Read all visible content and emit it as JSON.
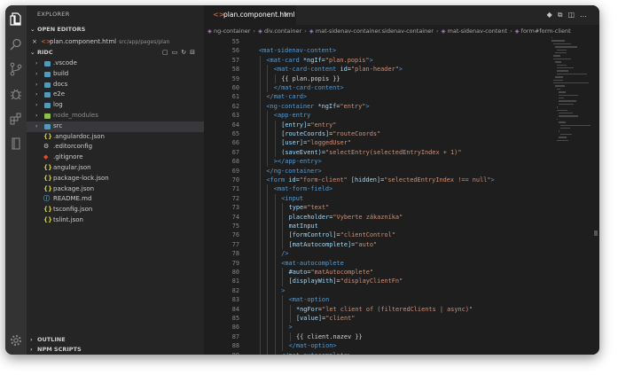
{
  "activity_bar": {
    "icons": [
      "files-icon",
      "search-icon",
      "source-control-icon",
      "debug-icon",
      "extensions-icon",
      "book-icon",
      "gear-icon"
    ]
  },
  "sidebar": {
    "title": "EXPLORER",
    "open_editors": {
      "label": "OPEN EDITORS",
      "file": "plan.component.html",
      "path": "src/app/pages/plan"
    },
    "root": {
      "label": "RIDC"
    },
    "tree": [
      {
        "name": ".vscode",
        "type": "folder",
        "color": "#519aba"
      },
      {
        "name": "build",
        "type": "folder",
        "color": "#519aba"
      },
      {
        "name": "docs",
        "type": "folder",
        "color": "#519aba"
      },
      {
        "name": "e2e",
        "type": "folder",
        "color": "#519aba"
      },
      {
        "name": "log",
        "type": "folder",
        "color": "#519aba"
      },
      {
        "name": "node_modules",
        "type": "folder",
        "color": "#8dc149",
        "dim": true
      },
      {
        "name": "src",
        "type": "folder",
        "color": "#519aba",
        "selected": true
      },
      {
        "name": ".angulardoc.json",
        "type": "file",
        "glyph": "{}",
        "color": "#cbcb41"
      },
      {
        "name": ".editorconfig",
        "type": "file",
        "glyph": "⚙",
        "color": "#cccccc"
      },
      {
        "name": ".gitignore",
        "type": "file",
        "glyph": "◆",
        "color": "#e44d26"
      },
      {
        "name": "angular.json",
        "type": "file",
        "glyph": "{}",
        "color": "#cbcb41"
      },
      {
        "name": "package-lock.json",
        "type": "file",
        "glyph": "{}",
        "color": "#cbcb41"
      },
      {
        "name": "package.json",
        "type": "file",
        "glyph": "{}",
        "color": "#cbcb41"
      },
      {
        "name": "README.md",
        "type": "file",
        "glyph": "ⓘ",
        "color": "#519aba"
      },
      {
        "name": "tsconfig.json",
        "type": "file",
        "glyph": "{}",
        "color": "#cbcb41"
      },
      {
        "name": "tslint.json",
        "type": "file",
        "glyph": "{}",
        "color": "#cbcb41"
      }
    ],
    "outline_label": "OUTLINE",
    "npm_label": "NPM SCRIPTS"
  },
  "editor": {
    "tab": {
      "label": "plan.component.html"
    },
    "breadcrumb": [
      "ng-container",
      "div.container",
      "mat-sidenav-container.sidenav-container",
      "mat-sidenav-content",
      "form#form-client"
    ],
    "lines": [
      {
        "n": "55",
        "indent": 0,
        "code": [
          [
            "p",
            "  "
          ]
        ]
      },
      {
        "n": "56",
        "indent": 0,
        "code": [
          [
            "t",
            "<mat-sidenav-content>"
          ]
        ]
      },
      {
        "n": "57",
        "indent": 1,
        "code": [
          [
            "t",
            "<mat-card "
          ],
          [
            "a",
            "*ngIf"
          ],
          [
            "p",
            "="
          ],
          [
            "s",
            "\"plan.popis\""
          ],
          [
            "t",
            ">"
          ]
        ]
      },
      {
        "n": "58",
        "indent": 2,
        "code": [
          [
            "t",
            "<mat-card-content "
          ],
          [
            "a",
            "id"
          ],
          [
            "p",
            "="
          ],
          [
            "s",
            "\"plan-header\""
          ],
          [
            "t",
            ">"
          ]
        ]
      },
      {
        "n": "59",
        "indent": 3,
        "code": [
          [
            "p",
            "{{ plan.popis }}"
          ]
        ]
      },
      {
        "n": "60",
        "indent": 2,
        "code": [
          [
            "t",
            "</mat-card-content>"
          ]
        ]
      },
      {
        "n": "61",
        "indent": 1,
        "code": [
          [
            "t",
            "</mat-card>"
          ]
        ]
      },
      {
        "n": "62",
        "indent": 1,
        "code": [
          [
            "t",
            "<ng-container "
          ],
          [
            "a",
            "*ngIf"
          ],
          [
            "p",
            "="
          ],
          [
            "s",
            "\"entry\""
          ],
          [
            "t",
            ">"
          ]
        ]
      },
      {
        "n": "63",
        "indent": 2,
        "code": [
          [
            "t",
            "<app-entry"
          ]
        ]
      },
      {
        "n": "64",
        "indent": 3,
        "code": [
          [
            "a",
            "[entry]"
          ],
          [
            "p",
            "="
          ],
          [
            "s",
            "\"entry\""
          ]
        ]
      },
      {
        "n": "65",
        "indent": 3,
        "code": [
          [
            "a",
            "[routeCoords]"
          ],
          [
            "p",
            "="
          ],
          [
            "s",
            "\"routeCoords\""
          ]
        ]
      },
      {
        "n": "66",
        "indent": 3,
        "code": [
          [
            "a",
            "[user]"
          ],
          [
            "p",
            "="
          ],
          [
            "s",
            "\"loggedUser\""
          ]
        ]
      },
      {
        "n": "67",
        "indent": 3,
        "code": [
          [
            "a",
            "(saveEvent)"
          ],
          [
            "p",
            "="
          ],
          [
            "s",
            "\"selectEntry(selectedEntryIndex + 1)\""
          ]
        ]
      },
      {
        "n": "68",
        "indent": 2,
        "code": [
          [
            "t",
            "></app-entry>"
          ]
        ]
      },
      {
        "n": "69",
        "indent": 1,
        "code": [
          [
            "t",
            "</ng-container>"
          ]
        ]
      },
      {
        "n": "70",
        "indent": 1,
        "code": [
          [
            "t",
            "<form "
          ],
          [
            "a",
            "id"
          ],
          [
            "p",
            "="
          ],
          [
            "s",
            "\"form-client\" "
          ],
          [
            "a",
            "[hidden]"
          ],
          [
            "p",
            "="
          ],
          [
            "s",
            "\"selectedEntryIndex !== null\""
          ],
          [
            "t",
            ">"
          ]
        ]
      },
      {
        "n": "71",
        "indent": 2,
        "code": [
          [
            "t",
            "<mat-form-field>"
          ]
        ]
      },
      {
        "n": "72",
        "indent": 3,
        "code": [
          [
            "t",
            "<input"
          ]
        ]
      },
      {
        "n": "73",
        "indent": 4,
        "code": [
          [
            "a",
            "type"
          ],
          [
            "p",
            "="
          ],
          [
            "s",
            "\"text\""
          ]
        ]
      },
      {
        "n": "74",
        "indent": 4,
        "code": [
          [
            "a",
            "placeholder"
          ],
          [
            "p",
            "="
          ],
          [
            "s",
            "\"Vyberte zákazníka\""
          ]
        ]
      },
      {
        "n": "75",
        "indent": 4,
        "code": [
          [
            "a",
            "matInput"
          ]
        ]
      },
      {
        "n": "76",
        "indent": 4,
        "code": [
          [
            "a",
            "[formControl]"
          ],
          [
            "p",
            "="
          ],
          [
            "s",
            "\"clientControl\""
          ]
        ]
      },
      {
        "n": "77",
        "indent": 4,
        "code": [
          [
            "a",
            "[matAutocomplete]"
          ],
          [
            "p",
            "="
          ],
          [
            "s",
            "\"auto\""
          ]
        ]
      },
      {
        "n": "78",
        "indent": 3,
        "code": [
          [
            "t",
            "/>"
          ]
        ]
      },
      {
        "n": "79",
        "indent": 3,
        "code": [
          [
            "t",
            "<mat-autocomplete"
          ]
        ]
      },
      {
        "n": "80",
        "indent": 4,
        "code": [
          [
            "a",
            "#auto"
          ],
          [
            "p",
            "="
          ],
          [
            "s",
            "\"matAutocomplete\""
          ]
        ]
      },
      {
        "n": "81",
        "indent": 4,
        "code": [
          [
            "a",
            "[displayWith]"
          ],
          [
            "p",
            "="
          ],
          [
            "s",
            "\"displayClientFn\""
          ]
        ]
      },
      {
        "n": "82",
        "indent": 3,
        "code": [
          [
            "t",
            ">"
          ]
        ]
      },
      {
        "n": "83",
        "indent": 4,
        "code": [
          [
            "t",
            "<mat-option"
          ]
        ]
      },
      {
        "n": "84",
        "indent": 5,
        "code": [
          [
            "a",
            "*ngFor"
          ],
          [
            "p",
            "="
          ],
          [
            "s",
            "\"let client of (filteredClients | async)\""
          ]
        ]
      },
      {
        "n": "85",
        "indent": 5,
        "code": [
          [
            "a",
            "[value]"
          ],
          [
            "p",
            "="
          ],
          [
            "s",
            "\"client\""
          ]
        ]
      },
      {
        "n": "86",
        "indent": 4,
        "code": [
          [
            "t",
            ">"
          ]
        ]
      },
      {
        "n": "87",
        "indent": 5,
        "code": [
          [
            "p",
            "{{ client.nazev }}"
          ]
        ]
      },
      {
        "n": "88",
        "indent": 4,
        "code": [
          [
            "t",
            "</mat-option>"
          ]
        ]
      },
      {
        "n": "89",
        "indent": 3,
        "code": [
          [
            "t",
            "</mat-autocomplete>"
          ]
        ]
      }
    ]
  },
  "theme": {
    "tag": "#569cd6",
    "attr": "#9cdcfe",
    "string": "#ce9178",
    "text": "#d4d4d4",
    "background": "#1e1e1e",
    "sidebar": "#252526",
    "activity": "#333333"
  }
}
